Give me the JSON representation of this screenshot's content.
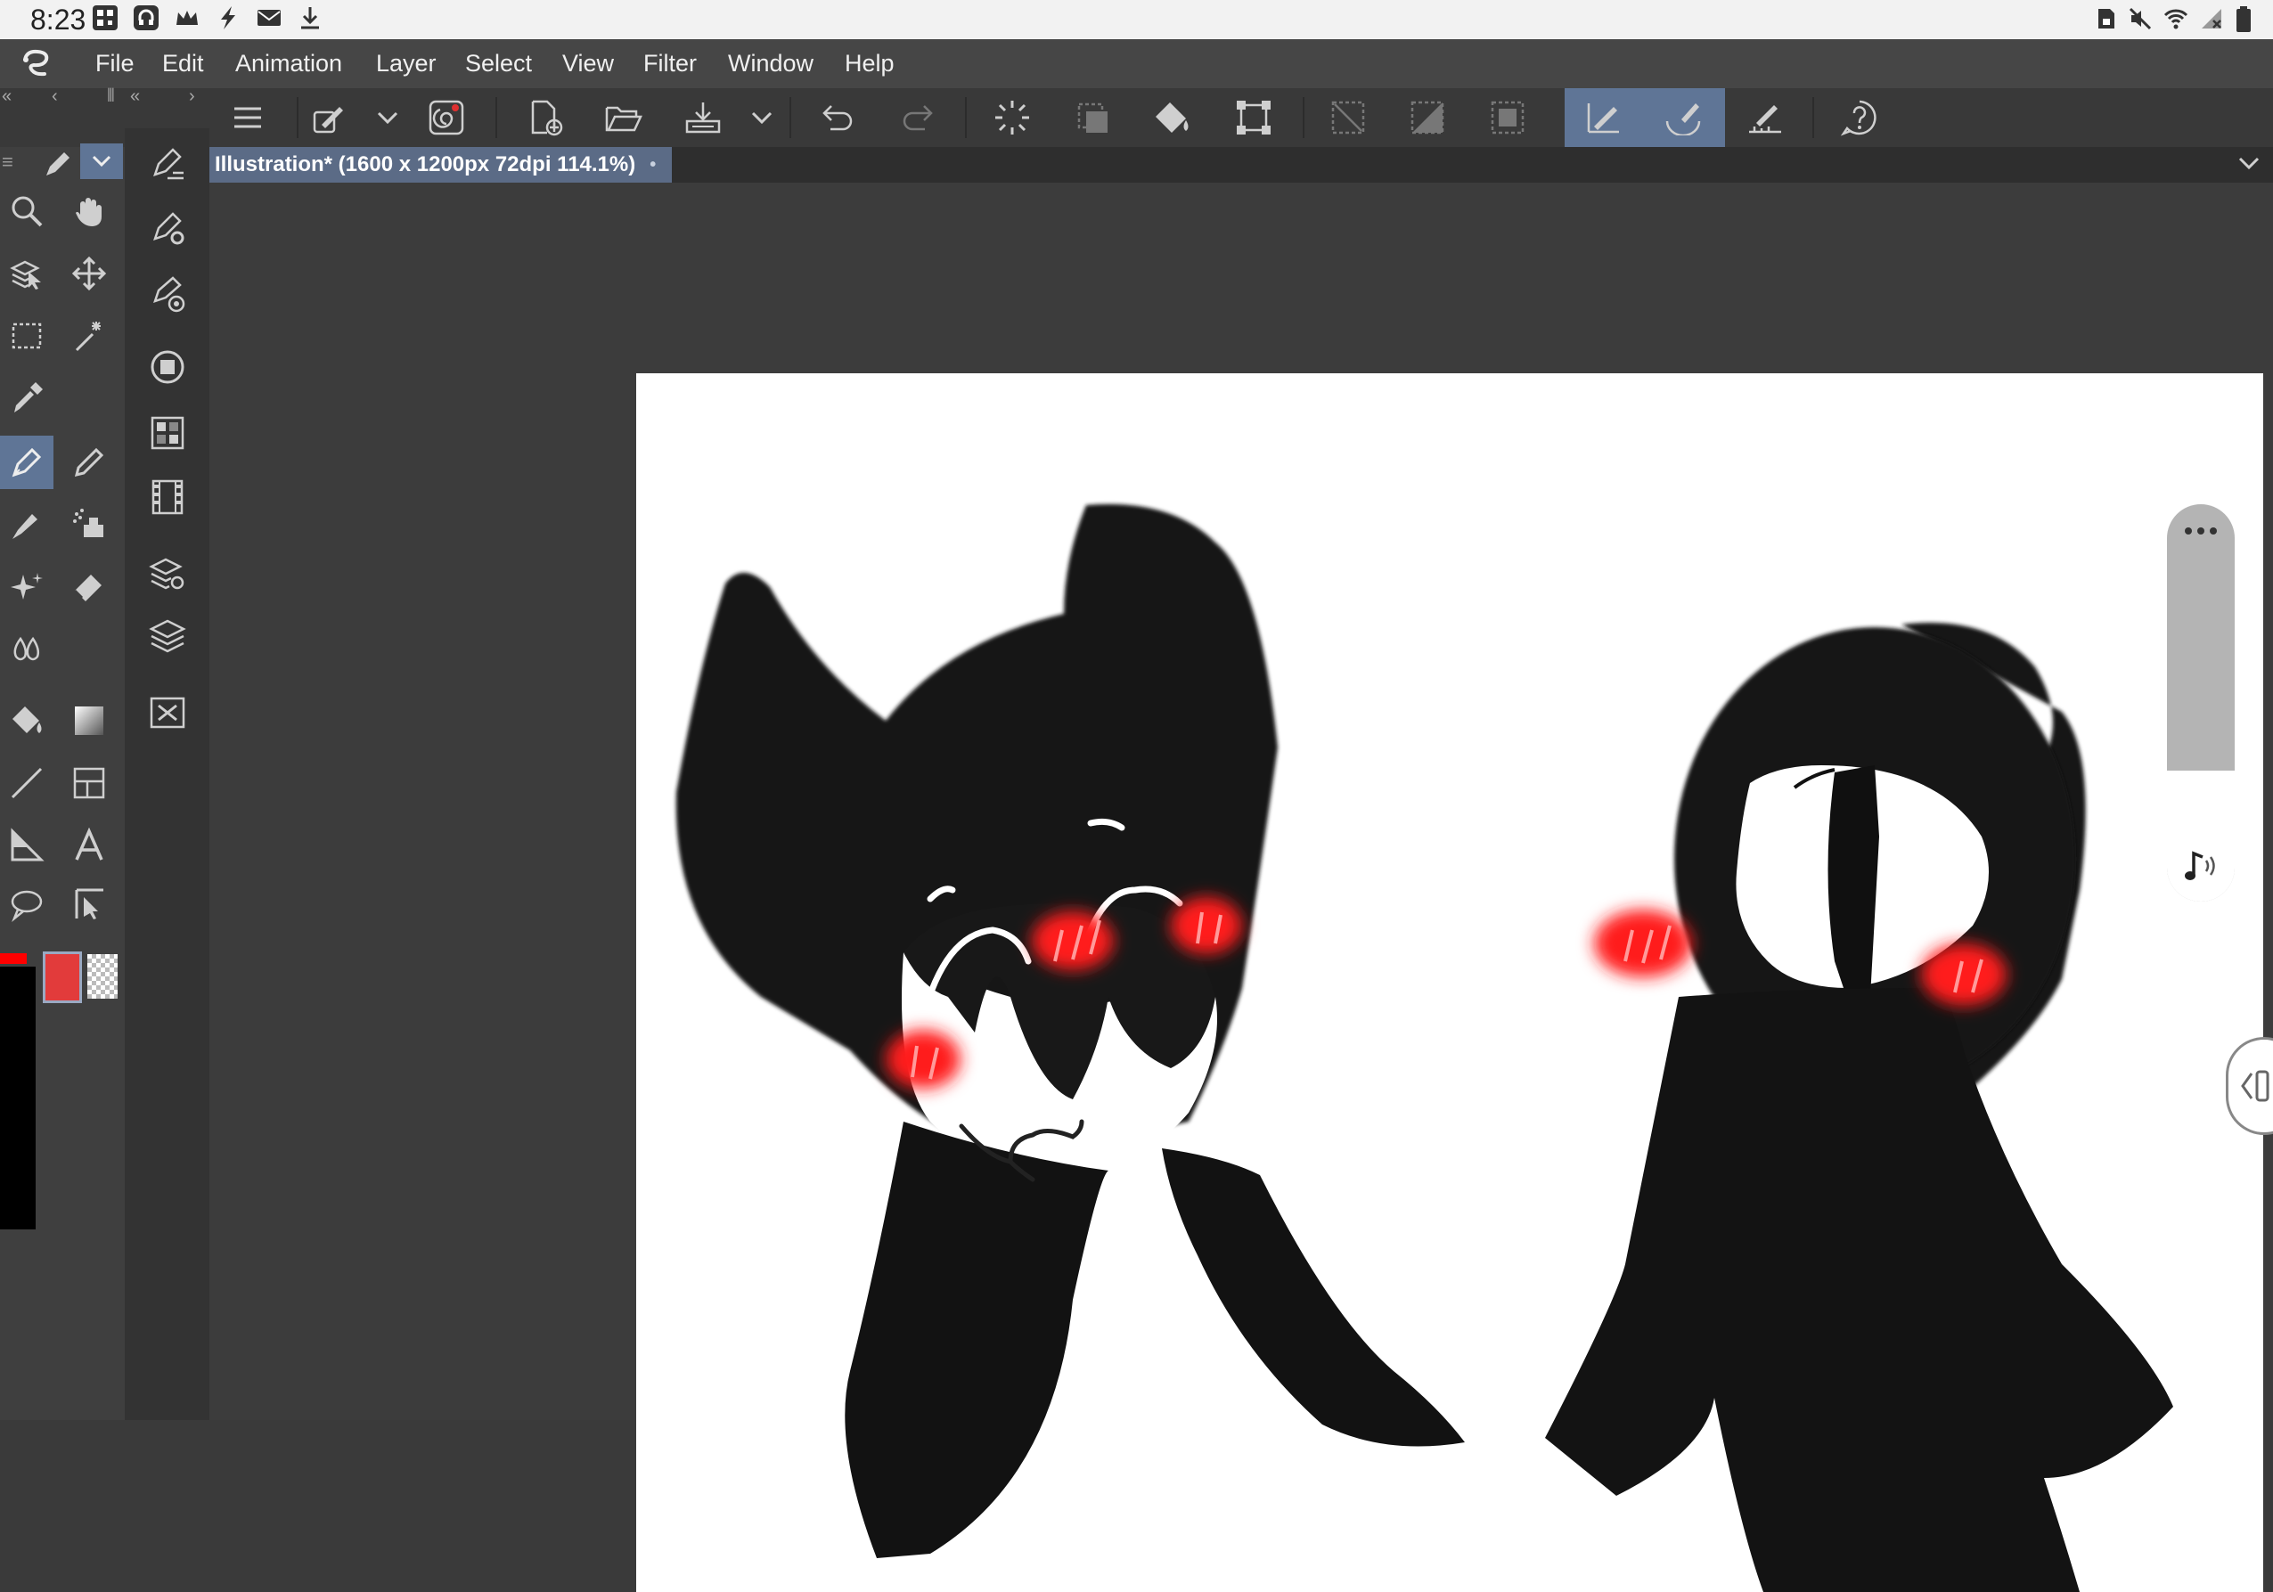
{
  "status_bar": {
    "time": "8:23",
    "left_icons": [
      "qr-code-icon",
      "headset-icon",
      "crown-icon",
      "spark-icon",
      "mail-icon",
      "download-icon"
    ],
    "right_icons": [
      "sim-lock-icon",
      "mute-icon",
      "wifi-icon",
      "no-signal-icon",
      "battery-icon"
    ]
  },
  "menu": {
    "logo_icon": "clip-studio-logo-icon",
    "items": [
      "File",
      "Edit",
      "Animation",
      "Layer",
      "Select",
      "View",
      "Filter",
      "Window",
      "Help"
    ]
  },
  "command_bar": {
    "icons": [
      "hamburger-menu-icon",
      "pen-settings-icon",
      "dropdown-chevron-icon",
      "brush-swirl-icon",
      "new-canvas-icon",
      "open-folder-icon",
      "save-icon",
      "dropdown-chevron-icon",
      "undo-icon",
      "redo-icon",
      "loading-spinner-icon",
      "selection-transform-icon",
      "fill-icon",
      "transform-icon",
      "clear-selection-icon",
      "invert-selection-icon",
      "select-all-icon",
      "stabilizer-pen-icon",
      "stabilizer-brush-icon",
      "ruler-pen-icon",
      "help-icon"
    ],
    "highlight_color": "#5f7596"
  },
  "document_tab": {
    "title": "Illustration* (1600 x 1200px 72dpi 114.1%)",
    "modified_dot": "•"
  },
  "tools": {
    "selected": "pen-tool",
    "items": [
      "zoom-tool",
      "hand-tool",
      "layer-select-tool",
      "move-tool",
      "rect-select-tool",
      "magic-wand-tool",
      "eyedropper-tool",
      "pen-tool",
      "pencil-tool",
      "brush-tool",
      "airbrush-tool",
      "decoration-tool",
      "eraser-tool",
      "blend-tool",
      "fill-tool",
      "gradient-tool",
      "line-tool",
      "frame-tool",
      "balloon-tool",
      "text-tool",
      "lasso-tool",
      "correct-line-tool"
    ],
    "main_color": "#e23b3b",
    "sub_color": "transparent",
    "color_bar": "#000000",
    "accent_red": "#ff0000"
  },
  "sub_panel": {
    "icons": [
      "pen-property-icon",
      "pen-sub-tool-settings-icon",
      "pen-detail-icon",
      "color-circle-icon",
      "color-set-icon",
      "animation-timeline-icon",
      "layer-property-icon",
      "layers-icon",
      "navigator-icon"
    ]
  },
  "volume_slider": {
    "menu_icon": "more-dots-icon",
    "mode_icon": "music-note-icon",
    "level_fraction": 0.33
  },
  "artwork": {
    "figure_color": "#111111",
    "blush_color": "#ff1a1a",
    "canvas_color": "#ffffff"
  }
}
